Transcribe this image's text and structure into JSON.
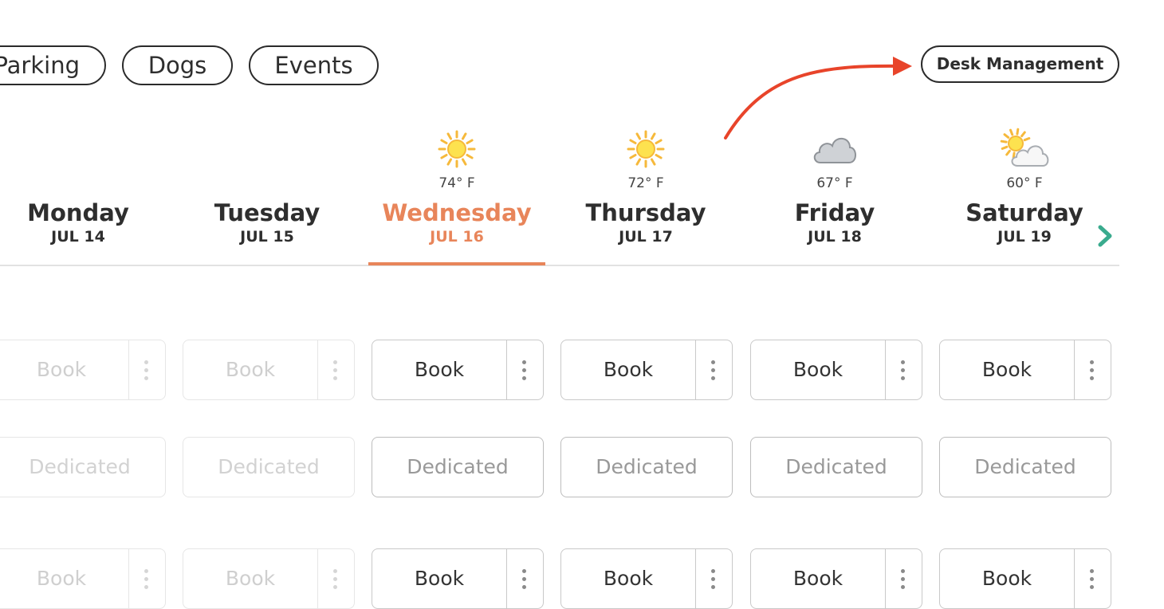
{
  "filters": [
    {
      "label": "Parking"
    },
    {
      "label": "Dogs"
    },
    {
      "label": "Events"
    }
  ],
  "desk_management": {
    "label": "Desk Management"
  },
  "annotation": {
    "arrow_color": "#e8442a"
  },
  "accent_color": "#e8855a",
  "days": [
    {
      "name": "Monday",
      "date": "JUL 14",
      "temp": "",
      "weather": "",
      "active": false
    },
    {
      "name": "Tuesday",
      "date": "JUL 15",
      "temp": "",
      "weather": "",
      "active": false
    },
    {
      "name": "Wednesday",
      "date": "JUL 16",
      "temp": "74° F",
      "weather": "sun-icon",
      "active": true
    },
    {
      "name": "Thursday",
      "date": "JUL 17",
      "temp": "72° F",
      "weather": "sun-icon",
      "active": false
    },
    {
      "name": "Friday",
      "date": "JUL 18",
      "temp": "67° F",
      "weather": "cloud-icon",
      "active": false
    },
    {
      "name": "Saturday",
      "date": "JUL 19",
      "temp": "60° F",
      "weather": "partly-cloudy-icon",
      "active": false
    }
  ],
  "next_icon": "chevron-right-icon",
  "rows": [
    {
      "type": "book",
      "cells": [
        {
          "label": "Book",
          "disabled": true
        },
        {
          "label": "Book",
          "disabled": true
        },
        {
          "label": "Book",
          "disabled": false
        },
        {
          "label": "Book",
          "disabled": false
        },
        {
          "label": "Book",
          "disabled": false
        },
        {
          "label": "Book",
          "disabled": false
        }
      ]
    },
    {
      "type": "dedicated",
      "cells": [
        {
          "label": "Dedicated",
          "disabled": true
        },
        {
          "label": "Dedicated",
          "disabled": true
        },
        {
          "label": "Dedicated",
          "disabled": false
        },
        {
          "label": "Dedicated",
          "disabled": false
        },
        {
          "label": "Dedicated",
          "disabled": false
        },
        {
          "label": "Dedicated",
          "disabled": false
        }
      ]
    },
    {
      "type": "book",
      "cells": [
        {
          "label": "Book",
          "disabled": true
        },
        {
          "label": "Book",
          "disabled": true
        },
        {
          "label": "Book",
          "disabled": false
        },
        {
          "label": "Book",
          "disabled": false
        },
        {
          "label": "Book",
          "disabled": false
        },
        {
          "label": "Book",
          "disabled": false
        }
      ]
    }
  ]
}
